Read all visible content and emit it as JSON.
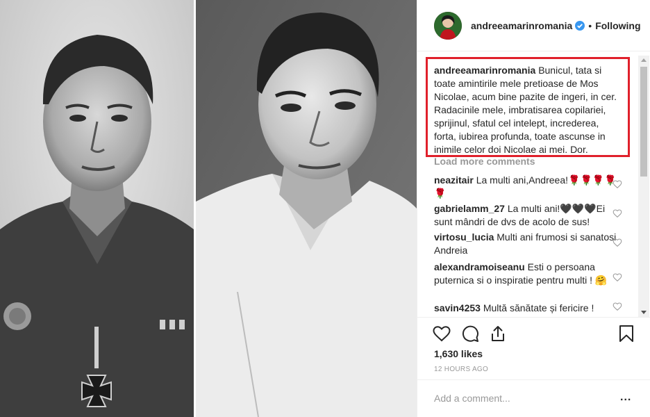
{
  "post": {
    "username": "andreeamarinromania",
    "separator": "•",
    "follow_status": "Following",
    "caption_author": "andreeamarinromania",
    "caption_text": "Bunicul, tata si toate amintirile mele pretioase de Mos Nicolae, acum bine pazite de ingeri, in cer. Radacinile mele, imbratisarea copilariei, sprijinul, sfatul cel intelept, increderea, forta, iubirea profunda, toate ascunse in inimile celor doi Nicolae ai mei. Dor.",
    "load_more": "Load more comments",
    "likes": "1,630 likes",
    "time": "12 HOURS AGO",
    "add_comment_placeholder": "Add a comment...",
    "more_options": "..."
  },
  "comments": [
    {
      "author": "neazitair",
      "text": "La multi ani,Andreea!🌹🌹🌹🌹 🌹"
    },
    {
      "author": "gabrielamm_27",
      "text": "La multi ani!🖤🖤🖤Ei sunt mândri de dvs de acolo de sus!"
    },
    {
      "author": "virtosu_lucia",
      "text": "Multi ani frumosi si sanatosi Andreia"
    },
    {
      "author": "alexandramoiseanu",
      "text": "Esti o persoana puternica si o inspiratie pentru multi ! 🤗"
    },
    {
      "author": "savin4253",
      "text": "Multă sănătate și fericire !"
    }
  ],
  "colors": {
    "highlight_border": "#e0202b",
    "verified_blue": "#3897f0",
    "muted_text": "#999999"
  },
  "icons": [
    "heart-icon",
    "comment-icon",
    "share-icon",
    "bookmark-icon",
    "verified-badge-icon",
    "small-heart-icon"
  ]
}
